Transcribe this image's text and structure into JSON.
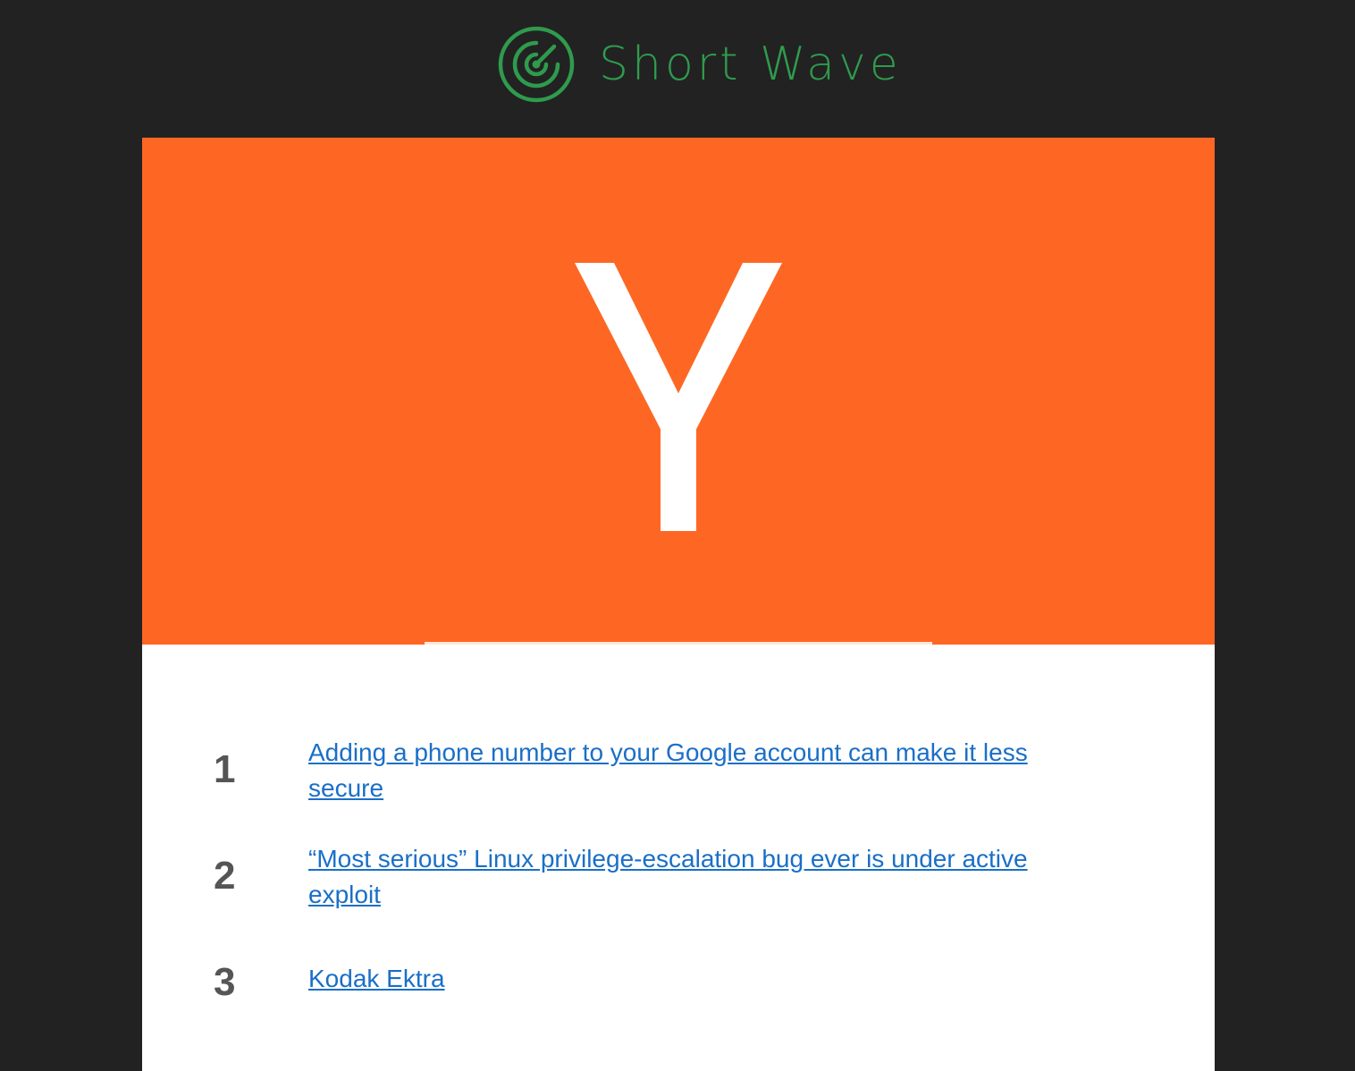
{
  "brand": {
    "name": "Short Wave",
    "logo_icon": "radar-icon",
    "color": "#2f9b4d"
  },
  "hero": {
    "letter": "Y",
    "background_color": "#fe6723"
  },
  "stories": [
    {
      "rank": "1",
      "title": "Adding a phone number to your Google account can make it less secure"
    },
    {
      "rank": "2",
      "title": "“Most serious” Linux privilege-escalation bug ever is under active exploit"
    },
    {
      "rank": "3",
      "title": "Kodak Ektra"
    }
  ],
  "colors": {
    "page_background": "#222222",
    "link": "#1a6fc7",
    "rank": "#555555"
  }
}
